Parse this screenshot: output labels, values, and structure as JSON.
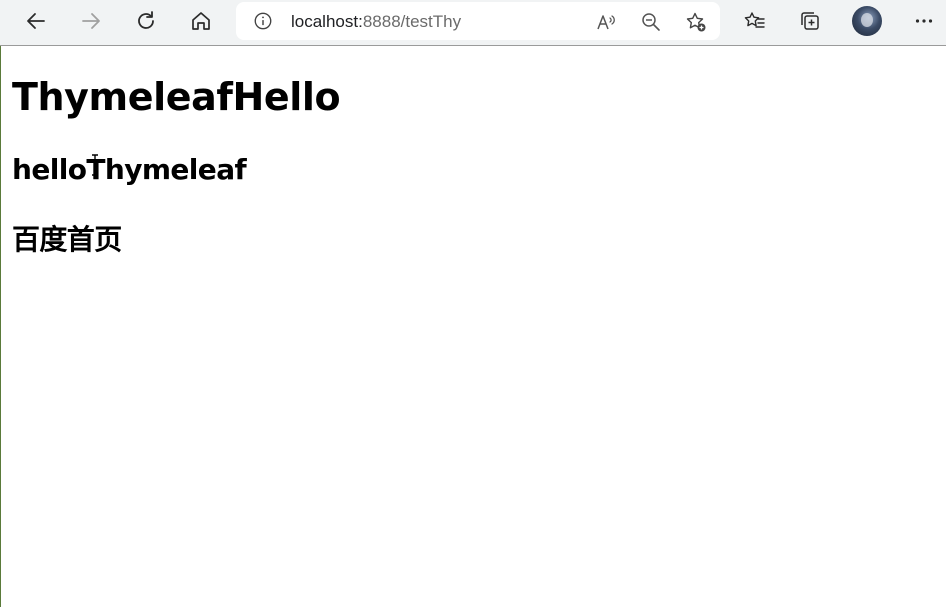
{
  "browser": {
    "url_host": "localhost:",
    "url_path": "8888/testThy",
    "icons": [
      "back-icon",
      "forward-icon",
      "refresh-icon",
      "home-icon",
      "info-icon",
      "read-aloud-icon",
      "zoom-out-icon",
      "add-favorite-icon",
      "favorites-icon",
      "collections-icon",
      "profile-avatar",
      "more-icon"
    ]
  },
  "page": {
    "heading1": "ThymeleafHello",
    "heading2": "helloThymeleaf",
    "link_heading": "百度首页"
  },
  "colors": {
    "toolbar_bg": "#f1f3f4",
    "page_bg": "#ffffff",
    "text": "#000000"
  }
}
